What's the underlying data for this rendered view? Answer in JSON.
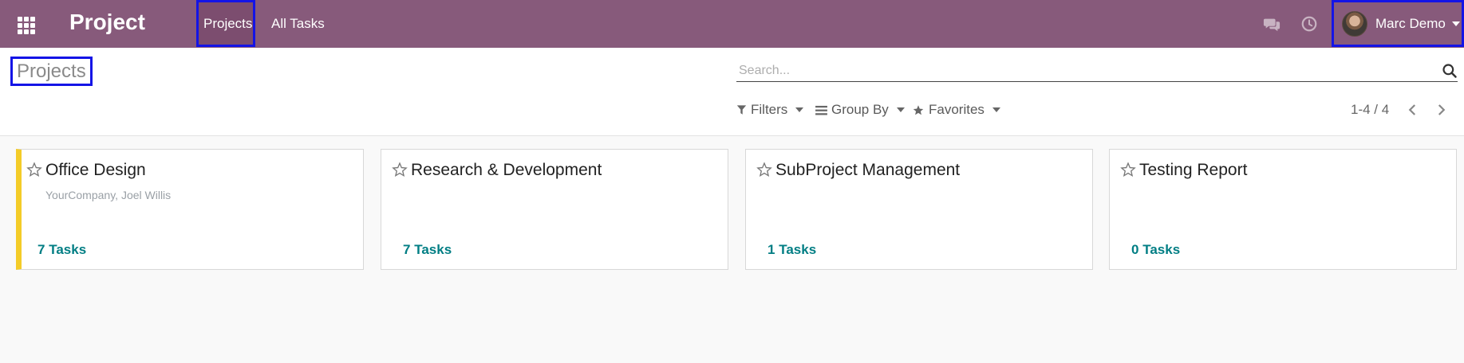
{
  "navbar": {
    "brand": "Project",
    "menu": [
      {
        "label": "Projects"
      },
      {
        "label": "All Tasks"
      }
    ],
    "user": {
      "name": "Marc Demo"
    },
    "bg_color": "#875a7b"
  },
  "control_panel": {
    "title": "Projects",
    "search": {
      "placeholder": "Search...",
      "value": ""
    },
    "filters_label": "Filters",
    "groupby_label": "Group By",
    "favorites_label": "Favorites",
    "pager": "1-4 / 4"
  },
  "projects": [
    {
      "name": "Office Design",
      "subtitle": "YourCompany, Joel Willis",
      "tasks_count": "7",
      "tasks_label": "Tasks",
      "color": "#f4cc28"
    },
    {
      "name": "Research & Development",
      "subtitle": "",
      "tasks_count": "7",
      "tasks_label": "Tasks"
    },
    {
      "name": "SubProject Management",
      "subtitle": "",
      "tasks_count": "1",
      "tasks_label": "Tasks"
    },
    {
      "name": "Testing Report",
      "subtitle": "",
      "tasks_count": "0",
      "tasks_label": "Tasks"
    }
  ],
  "icons": {
    "apps": "grid-icon",
    "chat": "chat-bubbles-icon",
    "activity": "clock-icon",
    "search": "search-icon",
    "filter": "funnel-icon",
    "groupby": "list-icon",
    "favorites": "star-icon",
    "prev": "chevron-left-icon",
    "next": "chevron-right-icon",
    "card_favorite": "star-outline-icon"
  }
}
